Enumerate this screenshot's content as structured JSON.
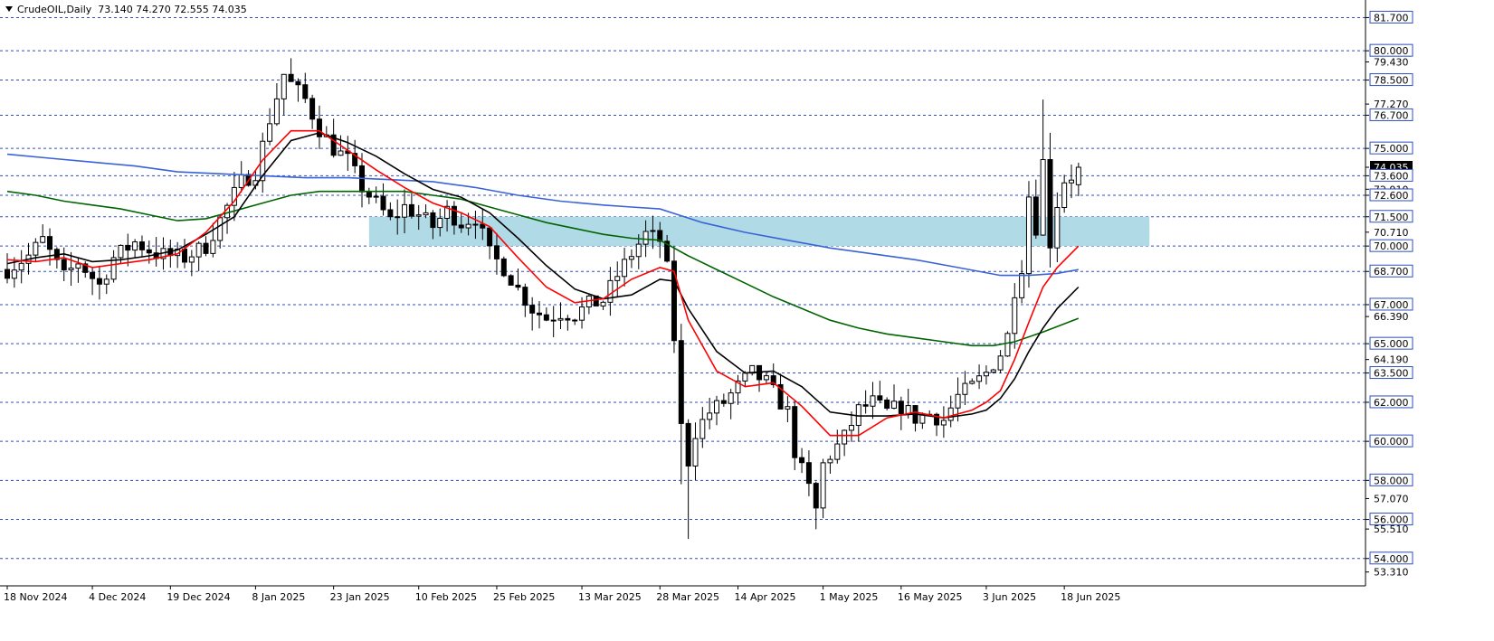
{
  "header": {
    "symbol": "CrudeOIL,Daily",
    "ohlc_text": "73.140 74.270 72.555 74.035"
  },
  "chart_data": {
    "type": "candlestick",
    "symbol": "CrudeOIL",
    "timeframe": "Daily",
    "last_price": 74.035,
    "ohlc": {
      "open": 73.14,
      "high": 74.27,
      "low": 72.555,
      "close": 74.035
    },
    "ylim": [
      52.6,
      82.6
    ],
    "grid": "horizontal dotted price levels",
    "price_levels": [
      81.7,
      80.0,
      78.5,
      76.7,
      75.0,
      73.6,
      72.6,
      71.5,
      70.0,
      68.7,
      67.0,
      65.0,
      63.5,
      62.0,
      60.0,
      58.0,
      56.0,
      54.0
    ],
    "scale_labels": [
      {
        "text": "81.700",
        "value": 81.7,
        "boxed": true
      },
      {
        "text": "80.000",
        "value": 80.0,
        "boxed": true
      },
      {
        "text": "79.430",
        "value": 79.43,
        "boxed": false
      },
      {
        "text": "78.500",
        "value": 78.5,
        "boxed": true
      },
      {
        "text": "77.270",
        "value": 77.27,
        "boxed": false
      },
      {
        "text": "76.700",
        "value": 76.7,
        "boxed": true
      },
      {
        "text": "75.000",
        "value": 75.0,
        "boxed": true
      },
      {
        "text": "74.035",
        "value": 74.035,
        "boxed": "current"
      },
      {
        "text": "73.600",
        "value": 73.6,
        "boxed": true
      },
      {
        "text": "72.910",
        "value": 72.91,
        "boxed": false
      },
      {
        "text": "72.600",
        "value": 72.6,
        "boxed": true
      },
      {
        "text": "71.500",
        "value": 71.5,
        "boxed": true
      },
      {
        "text": "70.710",
        "value": 70.71,
        "boxed": false
      },
      {
        "text": "70.000",
        "value": 70.0,
        "boxed": true
      },
      {
        "text": "68.700",
        "value": 68.7,
        "boxed": true
      },
      {
        "text": "67.000",
        "value": 67.0,
        "boxed": true
      },
      {
        "text": "66.390",
        "value": 66.39,
        "boxed": false
      },
      {
        "text": "65.000",
        "value": 65.0,
        "boxed": true
      },
      {
        "text": "64.190",
        "value": 64.19,
        "boxed": false
      },
      {
        "text": "63.500",
        "value": 63.5,
        "boxed": true
      },
      {
        "text": "62.000",
        "value": 62.0,
        "boxed": true
      },
      {
        "text": "60.000",
        "value": 60.0,
        "boxed": true
      },
      {
        "text": "58.000",
        "value": 58.0,
        "boxed": true
      },
      {
        "text": "57.070",
        "value": 57.07,
        "boxed": false
      },
      {
        "text": "56.000",
        "value": 56.0,
        "boxed": true
      },
      {
        "text": "55.510",
        "value": 55.51,
        "boxed": false
      },
      {
        "text": "54.000",
        "value": 54.0,
        "boxed": true
      },
      {
        "text": "53.310",
        "value": 53.31,
        "boxed": false
      }
    ],
    "x_labels": [
      {
        "text": "18 Nov 2024",
        "index": 0
      },
      {
        "text": "4 Dec 2024",
        "index": 12
      },
      {
        "text": "19 Dec 2024",
        "index": 23
      },
      {
        "text": "8 Jan 2025",
        "index": 35
      },
      {
        "text": "23 Jan 2025",
        "index": 46
      },
      {
        "text": "10 Feb 2025",
        "index": 58
      },
      {
        "text": "25 Feb 2025",
        "index": 69
      },
      {
        "text": "13 Mar 2025",
        "index": 81
      },
      {
        "text": "28 Mar 2025",
        "index": 92
      },
      {
        "text": "14 Apr 2025",
        "index": 103
      },
      {
        "text": "1 May 2025",
        "index": 115
      },
      {
        "text": "16 May 2025",
        "index": 126
      },
      {
        "text": "3 Jun 2025",
        "index": 138
      },
      {
        "text": "18 Jun 2025",
        "index": 149
      }
    ],
    "zone": {
      "x_start_index": 51,
      "x_end_index": 161,
      "y_low": 70.0,
      "y_high": 71.5,
      "color": "#add8e6"
    },
    "colors": {
      "ma_red": "#ff0000",
      "ma_black": "#000000",
      "ma_green": "#006400",
      "ma_blue": "#3a63d6",
      "grid": "#2e4fbf"
    },
    "price_path": [
      [
        0,
        68.8
      ],
      [
        3,
        69.5
      ],
      [
        5,
        70.3
      ],
      [
        8,
        68.4
      ],
      [
        10,
        69.2
      ],
      [
        13,
        68.0
      ],
      [
        15,
        69.4
      ],
      [
        18,
        70.2
      ],
      [
        21,
        69.6
      ],
      [
        25,
        69.4
      ],
      [
        28,
        70.0
      ],
      [
        31,
        72.0
      ],
      [
        33,
        73.3
      ],
      [
        35,
        73.8
      ],
      [
        37,
        76.5
      ],
      [
        39,
        78.8
      ],
      [
        40,
        78.3
      ],
      [
        42,
        77.5
      ],
      [
        44,
        76.0
      ],
      [
        46,
        75.0
      ],
      [
        48,
        74.4
      ],
      [
        50,
        73.0
      ],
      [
        52,
        72.2
      ],
      [
        54,
        71.3
      ],
      [
        56,
        72.0
      ],
      [
        58,
        71.6
      ],
      [
        60,
        71.0
      ],
      [
        62,
        71.8
      ],
      [
        64,
        71.2
      ],
      [
        66,
        71.5
      ],
      [
        68,
        69.6
      ],
      [
        70,
        68.9
      ],
      [
        72,
        67.8
      ],
      [
        74,
        66.8
      ],
      [
        76,
        66.3
      ],
      [
        78,
        66.6
      ],
      [
        80,
        66.5
      ],
      [
        82,
        67.0
      ],
      [
        84,
        67.2
      ],
      [
        86,
        68.5
      ],
      [
        88,
        69.6
      ],
      [
        90,
        70.6
      ],
      [
        92,
        70.3
      ],
      [
        93,
        68.8
      ],
      [
        94,
        65.3
      ],
      [
        95,
        60.7
      ],
      [
        96,
        59.0
      ],
      [
        97,
        60.5
      ],
      [
        99,
        61.5
      ],
      [
        101,
        62.0
      ],
      [
        103,
        62.8
      ],
      [
        105,
        63.5
      ],
      [
        107,
        63.0
      ],
      [
        109,
        62.0
      ],
      [
        110,
        61.5
      ],
      [
        111,
        59.5
      ],
      [
        112,
        58.5
      ],
      [
        113,
        57.6
      ],
      [
        114,
        56.5
      ],
      [
        115,
        58.8
      ],
      [
        116,
        59.3
      ],
      [
        118,
        60.2
      ],
      [
        120,
        61.6
      ],
      [
        122,
        62.0
      ],
      [
        124,
        61.5
      ],
      [
        126,
        61.8
      ],
      [
        128,
        61.2
      ],
      [
        130,
        61.4
      ],
      [
        132,
        61.1
      ],
      [
        134,
        62.3
      ],
      [
        136,
        62.8
      ],
      [
        138,
        63.5
      ],
      [
        140,
        64.5
      ],
      [
        141,
        65.4
      ],
      [
        142,
        67.8
      ],
      [
        143,
        69.0
      ],
      [
        144,
        72.6
      ],
      [
        145,
        71.0
      ],
      [
        146,
        74.3
      ],
      [
        147,
        70.2
      ],
      [
        148,
        72.2
      ],
      [
        149,
        73.4
      ],
      [
        150,
        73.6
      ],
      [
        151,
        74.035
      ]
    ],
    "series": [
      {
        "name": "",
        "color": "#3a63d6",
        "points": [
          [
            0,
            74.7
          ],
          [
            6,
            74.5
          ],
          [
            12,
            74.3
          ],
          [
            18,
            74.1
          ],
          [
            24,
            73.8
          ],
          [
            30,
            73.7
          ],
          [
            36,
            73.6
          ],
          [
            42,
            73.5
          ],
          [
            48,
            73.5
          ],
          [
            54,
            73.4
          ],
          [
            60,
            73.3
          ],
          [
            66,
            73.0
          ],
          [
            72,
            72.6
          ],
          [
            78,
            72.3
          ],
          [
            84,
            72.1
          ],
          [
            88,
            72.0
          ],
          [
            92,
            71.9
          ],
          [
            98,
            71.2
          ],
          [
            104,
            70.7
          ],
          [
            110,
            70.3
          ],
          [
            116,
            69.9
          ],
          [
            122,
            69.6
          ],
          [
            128,
            69.3
          ],
          [
            134,
            68.9
          ],
          [
            140,
            68.5
          ],
          [
            144,
            68.5
          ],
          [
            148,
            68.6
          ],
          [
            151,
            68.8
          ]
        ]
      },
      {
        "name": "",
        "color": "#006400",
        "points": [
          [
            0,
            72.8
          ],
          [
            4,
            72.6
          ],
          [
            8,
            72.3
          ],
          [
            12,
            72.1
          ],
          [
            16,
            71.9
          ],
          [
            20,
            71.6
          ],
          [
            24,
            71.3
          ],
          [
            28,
            71.4
          ],
          [
            32,
            71.8
          ],
          [
            36,
            72.2
          ],
          [
            40,
            72.6
          ],
          [
            44,
            72.8
          ],
          [
            48,
            72.8
          ],
          [
            52,
            72.8
          ],
          [
            56,
            72.8
          ],
          [
            60,
            72.6
          ],
          [
            64,
            72.4
          ],
          [
            68,
            72.0
          ],
          [
            72,
            71.6
          ],
          [
            76,
            71.2
          ],
          [
            80,
            70.9
          ],
          [
            84,
            70.6
          ],
          [
            88,
            70.4
          ],
          [
            92,
            70.3
          ],
          [
            96,
            69.5
          ],
          [
            100,
            68.8
          ],
          [
            104,
            68.1
          ],
          [
            108,
            67.4
          ],
          [
            112,
            66.8
          ],
          [
            116,
            66.2
          ],
          [
            120,
            65.8
          ],
          [
            124,
            65.5
          ],
          [
            128,
            65.3
          ],
          [
            132,
            65.1
          ],
          [
            136,
            64.9
          ],
          [
            139,
            64.9
          ],
          [
            142,
            65.1
          ],
          [
            146,
            65.6
          ],
          [
            151,
            66.3
          ]
        ]
      },
      {
        "name": "",
        "color": "#000000",
        "points": [
          [
            0,
            69.1
          ],
          [
            4,
            69.4
          ],
          [
            8,
            69.6
          ],
          [
            12,
            69.2
          ],
          [
            16,
            69.3
          ],
          [
            20,
            69.5
          ],
          [
            24,
            69.8
          ],
          [
            28,
            70.6
          ],
          [
            32,
            71.5
          ],
          [
            36,
            73.6
          ],
          [
            40,
            75.4
          ],
          [
            44,
            75.8
          ],
          [
            48,
            75.3
          ],
          [
            52,
            74.6
          ],
          [
            56,
            73.7
          ],
          [
            60,
            72.9
          ],
          [
            64,
            72.5
          ],
          [
            68,
            71.7
          ],
          [
            72,
            70.4
          ],
          [
            76,
            69.0
          ],
          [
            80,
            67.8
          ],
          [
            84,
            67.3
          ],
          [
            88,
            67.5
          ],
          [
            92,
            68.3
          ],
          [
            94,
            68.2
          ],
          [
            96,
            66.8
          ],
          [
            100,
            64.6
          ],
          [
            104,
            63.5
          ],
          [
            108,
            63.6
          ],
          [
            112,
            62.8
          ],
          [
            116,
            61.5
          ],
          [
            120,
            61.3
          ],
          [
            124,
            61.3
          ],
          [
            128,
            61.4
          ],
          [
            132,
            61.2
          ],
          [
            136,
            61.4
          ],
          [
            138,
            61.6
          ],
          [
            140,
            62.2
          ],
          [
            142,
            63.2
          ],
          [
            144,
            64.6
          ],
          [
            146,
            65.8
          ],
          [
            148,
            66.8
          ],
          [
            151,
            67.9
          ]
        ]
      },
      {
        "name": "",
        "color": "#ff0000",
        "points": [
          [
            0,
            69.3
          ],
          [
            4,
            69.2
          ],
          [
            8,
            69.4
          ],
          [
            12,
            68.9
          ],
          [
            16,
            69.1
          ],
          [
            20,
            69.3
          ],
          [
            24,
            69.6
          ],
          [
            28,
            70.7
          ],
          [
            32,
            72.3
          ],
          [
            36,
            74.4
          ],
          [
            40,
            75.9
          ],
          [
            44,
            75.9
          ],
          [
            48,
            74.9
          ],
          [
            52,
            73.9
          ],
          [
            56,
            73.0
          ],
          [
            60,
            72.2
          ],
          [
            64,
            71.7
          ],
          [
            68,
            71.0
          ],
          [
            72,
            69.4
          ],
          [
            76,
            67.9
          ],
          [
            80,
            67.1
          ],
          [
            84,
            67.3
          ],
          [
            88,
            68.3
          ],
          [
            92,
            68.9
          ],
          [
            94,
            68.7
          ],
          [
            96,
            66.2
          ],
          [
            100,
            63.6
          ],
          [
            104,
            62.8
          ],
          [
            108,
            63.0
          ],
          [
            112,
            61.8
          ],
          [
            116,
            60.3
          ],
          [
            120,
            60.3
          ],
          [
            124,
            61.2
          ],
          [
            128,
            61.5
          ],
          [
            132,
            61.2
          ],
          [
            136,
            61.6
          ],
          [
            138,
            62.0
          ],
          [
            140,
            62.6
          ],
          [
            142,
            64.2
          ],
          [
            144,
            66.1
          ],
          [
            146,
            67.9
          ],
          [
            148,
            68.9
          ],
          [
            151,
            70.0
          ]
        ]
      }
    ]
  }
}
